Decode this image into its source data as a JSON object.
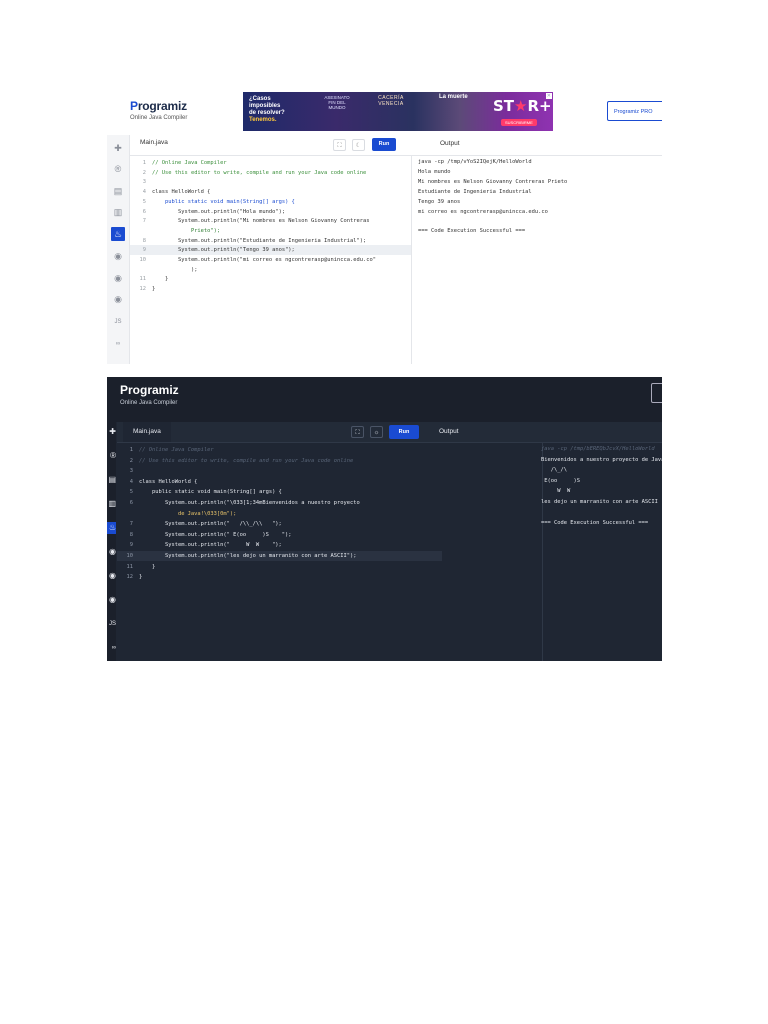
{
  "shot1": {
    "logo": {
      "name": "Programiz",
      "subtitle": "Online Java Compiler"
    },
    "ad": {
      "text_lines": [
        "¿Casos",
        "imposibles",
        "de resolver?"
      ],
      "cta": "Tenemos.",
      "title_2": "ASESINATO FIN DEL MUNDO",
      "title_3": "CACERÍA VENECIA",
      "title_4": "La muerte",
      "brand": "STAR+",
      "button": "SUSCRIBIRME",
      "close": "✕"
    },
    "pro_button": "Programiz PRO",
    "file_tab": "Main.java",
    "run_label": "Run",
    "output_tab": "Output",
    "clear_label": "C",
    "code": [
      {
        "n": "1",
        "text": "// Online Java Compiler",
        "kind": "cm"
      },
      {
        "n": "2",
        "text": "// Use this editor to write, compile and run your Java code online",
        "kind": "cm"
      },
      {
        "n": "3",
        "text": "",
        "kind": "ct"
      },
      {
        "n": "4",
        "text": "class HelloWorld {",
        "kind": "ct"
      },
      {
        "n": "5",
        "text": "    public static void main(String[] args) {",
        "kind": "kw"
      },
      {
        "n": "6",
        "text": "        System.out.println(\"Hola mundo\");",
        "kind": "ct"
      },
      {
        "n": "7",
        "text": "        System.out.println(\"Mi nombres es Nelson Giovanny Contreras",
        "kind": "ct"
      },
      {
        "n": "",
        "text": "            Prieto\");",
        "kind": "st"
      },
      {
        "n": "8",
        "text": "        System.out.println(\"Estudiante de Ingenieria Industrial\");",
        "kind": "ct"
      },
      {
        "n": "9",
        "text": "        System.out.println(\"Tengo 39 anos\");",
        "kind": "ct",
        "highlight": true
      },
      {
        "n": "10",
        "text": "        System.out.println(\"mi correo es ngcontrerasp@unincca.edu.co\"",
        "kind": "ct"
      },
      {
        "n": "",
        "text": "            );",
        "kind": "ct"
      },
      {
        "n": "11",
        "text": "    }",
        "kind": "ct"
      },
      {
        "n": "12",
        "text": "}",
        "kind": "ct"
      }
    ],
    "output": [
      "java -cp /tmp/vYoS2IQejK/HelloWorld",
      "Hola mundo",
      "Mi nombres es Nelson Giovanny Contreras Prieto",
      "Estudiante de Ingenieria Industrial",
      "Tengo 39 anos",
      "mi correo es ngcontrerasp@unincca.edu.co",
      "",
      "=== Code Execution Successful ==="
    ]
  },
  "shot2": {
    "logo": {
      "name": "Programiz",
      "subtitle": "Online Java Compiler"
    },
    "file_tab": "Main.java",
    "run_label": "Run",
    "output_tab": "Output",
    "code": [
      {
        "n": "1",
        "text": "// Online Java Compiler",
        "kind": "cm"
      },
      {
        "n": "2",
        "text": "// Use this editor to write, compile and run your Java code online",
        "kind": "cm"
      },
      {
        "n": "3",
        "text": "",
        "kind": "ct"
      },
      {
        "n": "4",
        "text": "class HelloWorld {",
        "kind": "ct"
      },
      {
        "n": "5",
        "text": "    public static void main(String[] args) {",
        "kind": "ct"
      },
      {
        "n": "6",
        "text": "        System.out.println(\"\\033[1;34mBienvenidos a nuestro proyecto",
        "kind": "ct"
      },
      {
        "n": "",
        "text": "            de Java!\\033[0m\");",
        "kind": "st"
      },
      {
        "n": "7",
        "text": "        System.out.println(\"   /\\\\_/\\\\   \");",
        "kind": "ct"
      },
      {
        "n": "8",
        "text": "        System.out.println(\" E(oo     )S    \");",
        "kind": "ct"
      },
      {
        "n": "9",
        "text": "        System.out.println(\"     W  W    \");",
        "kind": "ct"
      },
      {
        "n": "10",
        "text": "        System.out.println(\"les dejo un marranito con arte ASCII\");",
        "kind": "ct",
        "highlight": true
      },
      {
        "n": "11",
        "text": "    }",
        "kind": "ct"
      },
      {
        "n": "12",
        "text": "}",
        "kind": "ct"
      }
    ],
    "output": [
      "java -cp /tmp/bEREQbJcvX/HelloWorld",
      "Bienvenidos a nuestro proyecto de Java!",
      "   /\\_/\\",
      " E(oo     )S",
      "     W  W",
      "les dejo un marranito con arte ASCII",
      "",
      "=== Code Execution Successful ==="
    ]
  },
  "colors": {
    "accent": "#1a4bd1",
    "dark_bg": "#1f2633",
    "light_bg": "#ffffff"
  }
}
